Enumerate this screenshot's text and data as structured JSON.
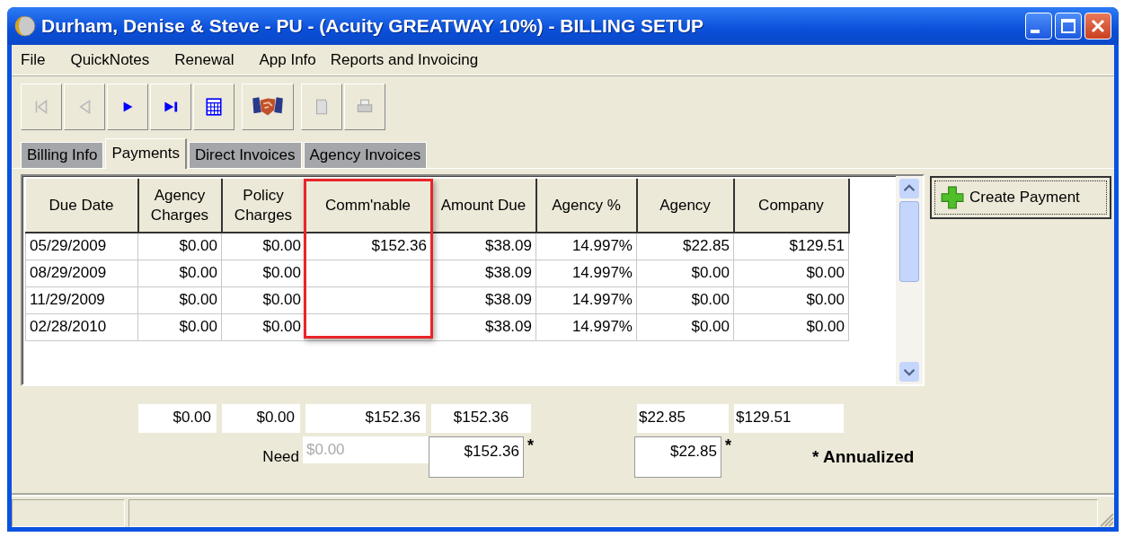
{
  "window": {
    "title": "Durham, Denise & Steve - PU - (Acuity GREATWAY 10%) - BILLING SETUP"
  },
  "menu": [
    "File",
    "QuickNotes",
    "Renewal",
    "App Info",
    "Reports and Invoicing"
  ],
  "toolbar": [
    {
      "kind": "first",
      "disabled": true
    },
    {
      "kind": "previous",
      "disabled": true
    },
    {
      "kind": "next",
      "disabled": false
    },
    {
      "kind": "last",
      "disabled": false
    },
    {
      "kind": "calendar",
      "disabled": false
    },
    {
      "kind": "handshake",
      "disabled": false
    },
    {
      "kind": "document",
      "disabled": true
    },
    {
      "kind": "printer",
      "disabled": true
    }
  ],
  "tabs": [
    {
      "label": "Billing Info",
      "selected": false
    },
    {
      "label": "Payments",
      "selected": true
    },
    {
      "label": "Direct Invoices",
      "selected": false
    },
    {
      "label": "Agency Invoices",
      "selected": false
    }
  ],
  "grid": {
    "columns": [
      {
        "label": "Due Date",
        "highlighted": false
      },
      {
        "label": "Agency Charges",
        "highlighted": false
      },
      {
        "label": "Policy Charges",
        "highlighted": false
      },
      {
        "label": "Comm'nable",
        "highlighted": true
      },
      {
        "label": "Amount Due",
        "highlighted": false
      },
      {
        "label": "Agency %",
        "highlighted": false
      },
      {
        "label": "Agency",
        "highlighted": false
      },
      {
        "label": "Company",
        "highlighted": false
      }
    ],
    "rows": [
      [
        "05/29/2009",
        "$0.00",
        "$0.00",
        "$152.36",
        "$38.09",
        "14.997%",
        "$22.85",
        "$129.51"
      ],
      [
        "08/29/2009",
        "$0.00",
        "$0.00",
        "",
        "$38.09",
        "14.997%",
        "$0.00",
        "$0.00"
      ],
      [
        "11/29/2009",
        "$0.00",
        "$0.00",
        "",
        "$38.09",
        "14.997%",
        "$0.00",
        "$0.00"
      ],
      [
        "02/28/2010",
        "$0.00",
        "$0.00",
        "",
        "$38.09",
        "14.997%",
        "$0.00",
        "$0.00"
      ]
    ]
  },
  "create_button": "Create Payment",
  "totals": {
    "agency_charges": "$0.00",
    "policy_charges": "$0.00",
    "commnable": "$152.36",
    "amount_due": "$152.36",
    "agency": "$22.85",
    "company": "$129.51"
  },
  "need": {
    "label": "Need",
    "value": "$0.00",
    "disabled": true
  },
  "annualized": {
    "amount_due": {
      "value": "$152.36",
      "marker": "*"
    },
    "agency": {
      "value": "$22.85",
      "marker": "*"
    }
  },
  "note": "* Annualized"
}
